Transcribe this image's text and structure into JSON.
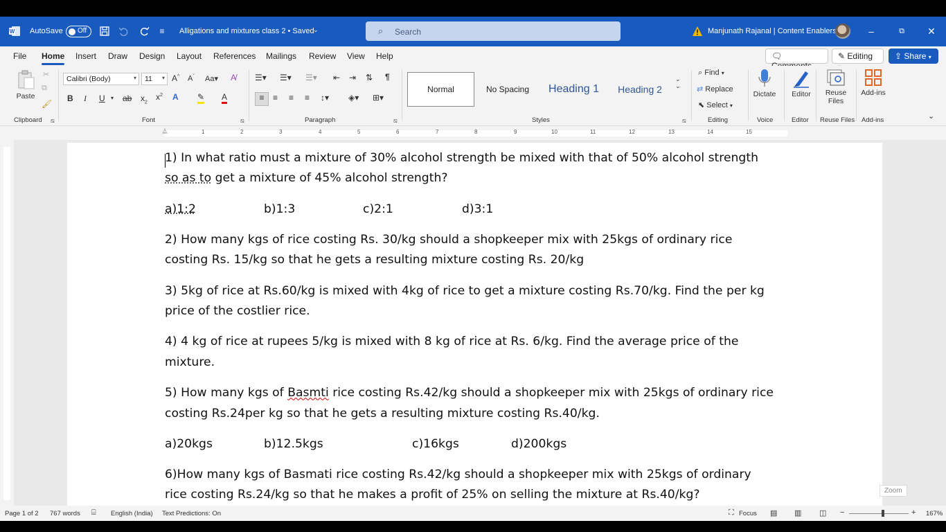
{
  "title_bar": {
    "autosave_label": "AutoSave",
    "autosave_state": "Off",
    "document_title": "Alligations and mixtures class 2 • Saved",
    "search_placeholder": "Search",
    "user_name": "Manjunath Rajanal | Content Enablers",
    "accent_color": "#185abd"
  },
  "menu": {
    "tabs": [
      "File",
      "Home",
      "Insert",
      "Draw",
      "Design",
      "Layout",
      "References",
      "Mailings",
      "Review",
      "View",
      "Help"
    ],
    "active_tab": "Home",
    "comments_label": "Comments",
    "editing_label": "Editing",
    "share_label": "Share"
  },
  "ribbon": {
    "clipboard": {
      "paste_label": "Paste",
      "group_label": "Clipboard"
    },
    "font": {
      "font_name": "Calibri (Body)",
      "font_size": "11",
      "group_label": "Font"
    },
    "paragraph": {
      "group_label": "Paragraph"
    },
    "styles": {
      "normal": "Normal",
      "no_spacing": "No Spacing",
      "heading1": "Heading 1",
      "heading2": "Heading 2",
      "group_label": "Styles"
    },
    "editing": {
      "find": "Find",
      "replace": "Replace",
      "select": "Select",
      "group_label": "Editing"
    },
    "voice": {
      "dictate": "Dictate",
      "group_label": "Voice"
    },
    "editor": {
      "label": "Editor",
      "group_label": "Editor"
    },
    "reuse": {
      "label_line1": "Reuse",
      "label_line2": "Files",
      "group_label": "Reuse Files"
    },
    "addins": {
      "label": "Add-ins",
      "group_label": "Add-ins"
    }
  },
  "ruler": {
    "numbers": [
      "1",
      "2",
      "3",
      "4",
      "5",
      "6",
      "7",
      "8",
      "9",
      "10",
      "11",
      "12",
      "13",
      "14",
      "15"
    ]
  },
  "document": {
    "q1_line1": "1) In what ratio must a mixture of 30% alcohol strength be mixed with that of 50% alcohol strength",
    "q1_line2_a": "so as to",
    "q1_line2_b": " get a mixture of 45% alcohol strength?",
    "q1_opt_a": "a)1:2",
    "q1_opt_b": "b)1:3",
    "q1_opt_c": "c)2:1",
    "q1_opt_d": "d)3:1",
    "q2_line1": "2) How many kgs of rice costing Rs. 30/kg should a shopkeeper mix with 25kgs of ordinary rice",
    "q2_line2": "costing Rs. 15/kg so that he gets a resulting mixture costing Rs. 20/kg",
    "q3_line1": "3) 5kg of rice at Rs.60/kg is mixed with 4kg of rice to get a mixture costing Rs.70/kg. Find the per kg",
    "q3_line2": "price of the costlier rice.",
    "q4_line1": "4) 4 kg of rice at rupees 5/kg is mixed with 8 kg of rice at Rs. 6/kg. Find the average price of the",
    "q4_line2": "mixture.",
    "q5_line1_a": "5) How many kgs of ",
    "q5_line1_b": "Basmti",
    "q5_line1_c": " rice costing Rs.42/kg should a shopkeeper mix with 25kgs of ordinary rice",
    "q5_line2": "costing Rs.24per kg so that he gets a resulting mixture costing Rs.40/kg.",
    "q5_opt_a": "a)20kgs",
    "q5_opt_b": "b)12.5kgs",
    "q5_opt_c": "c)16kgs",
    "q5_opt_d": "d)200kgs",
    "q6_line1": "6)How many kgs of Basmati rice costing Rs.42/kg should a shopkeeper mix with 25kgs of ordinary",
    "q6_line2": "rice costing Rs.24/kg so that he makes a profit of 25% on selling the mixture at Rs.40/kg?"
  },
  "status_bar": {
    "page": "Page 1 of 2",
    "words": "767 words",
    "language": "English (India)",
    "text_predictions": "Text Predictions: On",
    "focus": "Focus",
    "zoom_tooltip": "Zoom",
    "zoom_level": "167%"
  }
}
